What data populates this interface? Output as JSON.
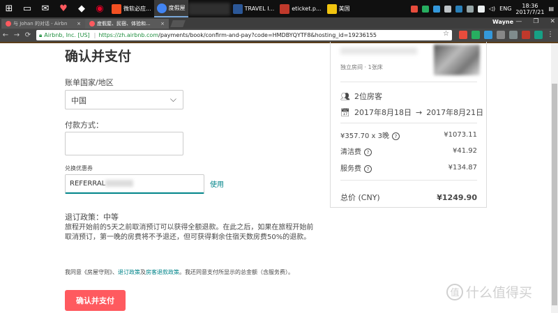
{
  "taskbar": {
    "apps": [
      {
        "label": "微软必应...",
        "color": "#f25022"
      },
      {
        "label": "度假屋",
        "color": "#4285f4"
      },
      {
        "label": "TRAVEL I...",
        "color": "#2b5797"
      },
      {
        "label": "eticket.p...",
        "color": "#c0392b"
      },
      {
        "label": "美国",
        "color": "#f1c40f"
      }
    ],
    "lang": "ENG",
    "time": "18:36",
    "date": "2017/7/21"
  },
  "browser": {
    "tabs": [
      {
        "label": "与 Johan 的对话 - Airbn"
      },
      {
        "label": "度假屋、民宿、体验和..."
      }
    ],
    "user": "Wayne",
    "secure_label": "Airbnb, Inc. [US]",
    "url_host": "https://zh.airbnb.com",
    "url_path": "/payments/book/confirm-and-pay?code=HMDBYQYTF8&hosting_id=19236155"
  },
  "form": {
    "title": "确认并支付",
    "country_label": "账单国家/地区",
    "country_value": "中国",
    "payment_label": "付款方式：",
    "coupon_label": "兑换优惠券",
    "coupon_value": "REFERRAL",
    "apply_label": "使用",
    "policy_title": "退订政策：中等",
    "policy_text": "旅程开始前的5天之前取消预订可以获得全额退款。在此之后，如果在旅程开始前取消预订，第一晚的房费将不予退还，但可获得剩余住宿天数房费50%的退款。",
    "agree_prefix": "我同意《房屋守则》、",
    "agree_link1": "退订政策",
    "agree_mid": "及",
    "agree_link2": "房客退款政策",
    "agree_suffix": "。我还同意支付所显示的总金额（含服务费）。",
    "pay_button": "确认并支付"
  },
  "summary": {
    "room_type": "独立房间 · 1张床",
    "guests": "2位房客",
    "checkin": "2017年8月18日",
    "checkout": "2017年8月21日",
    "nightly_label": "¥357.70 x 3晚",
    "nightly_amount": "¥1073.11",
    "cleaning_label": "清洁费",
    "cleaning_amount": "¥41.92",
    "service_label": "服务费",
    "service_amount": "¥134.87",
    "total_label": "总价 (CNY)",
    "total_amount": "¥1249.90"
  },
  "watermark": {
    "badge": "值",
    "text": "什么值得买"
  }
}
